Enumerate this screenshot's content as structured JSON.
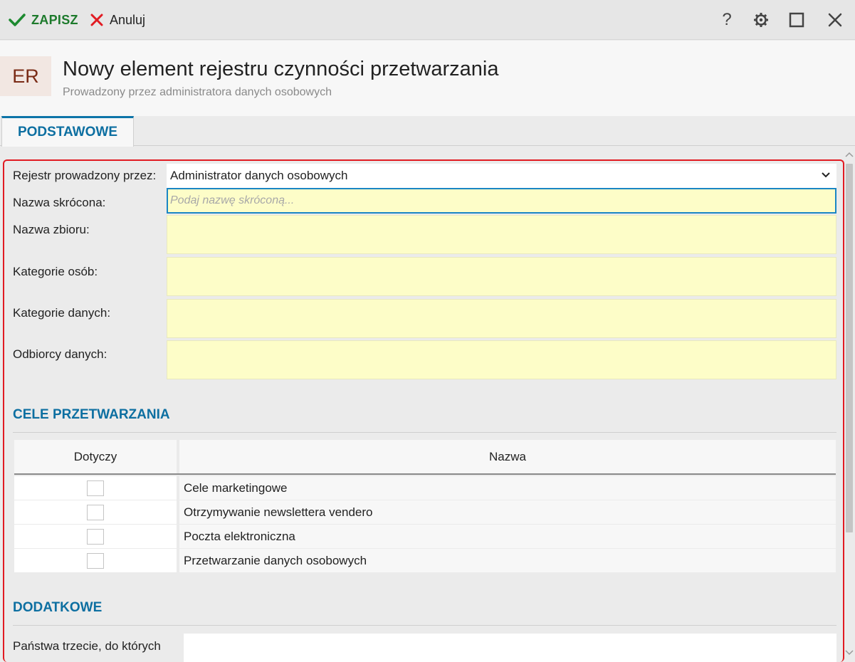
{
  "toolbar": {
    "save_label": "ZAPISZ",
    "cancel_label": "Anuluj",
    "help_label": "?"
  },
  "header": {
    "badge": "ER",
    "title": "Nowy element rejestru czynności przetwarzania",
    "subtitle": "Prowadzony przez administratora danych osobowych"
  },
  "tabs": [
    {
      "label": "PODSTAWOWE",
      "active": true
    }
  ],
  "form": {
    "register_label": "Rejestr prowadzony przez:",
    "register_value": "Administrator danych osobowych",
    "short_name_label": "Nazwa skrócona:",
    "short_name_placeholder": "Podaj nazwę skróconą...",
    "short_name_value": "",
    "set_name_label": "Nazwa zbioru:",
    "person_categories_label": "Kategorie osób:",
    "data_categories_label": "Kategorie danych:",
    "recipients_label": "Odbiorcy danych:"
  },
  "purposes": {
    "title": "CELE PRZETWARZANIA",
    "columns": [
      "Dotyczy",
      "Nazwa"
    ],
    "rows": [
      {
        "checked": false,
        "name": "Cele marketingowe"
      },
      {
        "checked": false,
        "name": "Otrzymywanie newslettera vendero"
      },
      {
        "checked": false,
        "name": "Poczta elektroniczna"
      },
      {
        "checked": false,
        "name": "Przetwarzanie danych osobowych"
      }
    ]
  },
  "additional": {
    "title": "DODATKOWE",
    "third_countries_label": "Państwa trzecie, do których"
  },
  "colors": {
    "accent": "#0d6fa1",
    "save_green": "#1d7a2c",
    "cancel_red": "#e11b22",
    "required_field": "#fdfdc8",
    "highlight_border": "#e11b22"
  }
}
